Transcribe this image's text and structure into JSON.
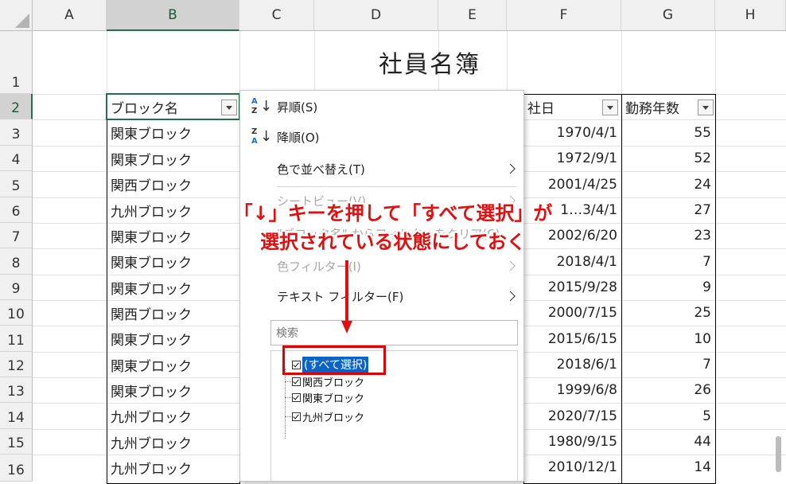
{
  "columns": [
    "A",
    "B",
    "C",
    "D",
    "E",
    "F",
    "G",
    "H"
  ],
  "rows": [
    "1",
    "2",
    "3",
    "4",
    "5",
    "6",
    "7",
    "8",
    "9",
    "10",
    "11",
    "12",
    "13",
    "14",
    "15",
    "16"
  ],
  "sheet_title": "社員名簿",
  "headers": {
    "block": "ブロック名",
    "join_partial": "社日",
    "years": "勤務年数"
  },
  "block_values": [
    "関東ブロック",
    "関東ブロック",
    "関西ブロック",
    "九州ブロック",
    "関東ブロック",
    "関東ブロック",
    "関東ブロック",
    "関西ブロック",
    "関東ブロック",
    "関東ブロック",
    "関東ブロック",
    "九州ブロック",
    "九州ブロック",
    "九州ブロック"
  ],
  "join_dates": [
    "1970/4/1",
    "1972/9/1",
    "2001/4/25",
    "1…3/4/1",
    "2002/6/20",
    "2018/4/1",
    "2015/9/28",
    "2000/7/15",
    "2015/6/15",
    "2018/6/1",
    "1999/6/8",
    "2020/7/15",
    "1980/9/15",
    "2010/12/1"
  ],
  "years": [
    "55",
    "52",
    "24",
    "27",
    "23",
    "7",
    "9",
    "25",
    "10",
    "7",
    "26",
    "5",
    "44",
    "14"
  ],
  "menu": {
    "sort_asc": "昇順(S)",
    "sort_desc": "降順(O)",
    "sort_by_color": "色で並べ替え(T)",
    "sheet_view": "シートビュー(V)",
    "clear_filter": "\"ブロック名\" からフィルターをクリア(C)",
    "color_filter": "色フィルター(I)",
    "text_filter": "テキスト フィルター(F)",
    "search_placeholder": "検索",
    "list": [
      "(すべて選択)",
      "関西ブロック",
      "関東ブロック",
      "九州ブロック"
    ]
  },
  "annotation": {
    "line1": "「↓」キーを押して「すべて選択」が",
    "line2": "選択されている状態にしておく"
  },
  "colors": {
    "accent_green": "#217346",
    "annotation_red": "#e01010",
    "selection_blue": "#0a64c8"
  }
}
